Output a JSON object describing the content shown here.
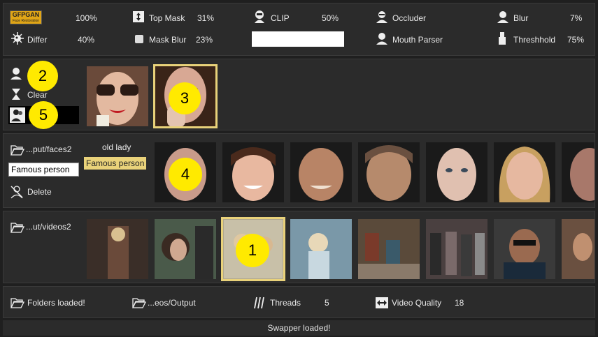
{
  "top": {
    "gfpgan_logo": "GFPGAN",
    "gfpgan_sub": "Face Restoration",
    "gfpgan_value": "100%",
    "top_mask_label": "Top Mask",
    "top_mask_value": "31%",
    "clip_label": "CLIP",
    "clip_value": "50%",
    "occluder_label": "Occluder",
    "blur_label": "Blur",
    "blur_value": "7%",
    "differ_label": "Differ",
    "differ_value": "40%",
    "mask_blur_label": "Mask Blur",
    "mask_blur_value": "23%",
    "clip_text": "",
    "mouth_parser_label": "Mouth Parser",
    "threshold_label": "Threshhold",
    "threshold_value": "75%"
  },
  "source": {
    "clear_label": "Clear",
    "markers": [
      "2",
      "5",
      "3"
    ]
  },
  "faces": {
    "folder_label": "...put/faces2",
    "name_value": "Famous person",
    "saved_name": "old lady",
    "highlight_name": "Famous person",
    "delete_label": "Delete",
    "marker": "4"
  },
  "videos": {
    "folder_label": "...ut/videos2",
    "marker": "1"
  },
  "bottom": {
    "folders_loaded": "Folders loaded!",
    "output_folder": "...eos/Output",
    "threads_label": "Threads",
    "threads_value": "5",
    "video_quality_label": "Video Quality",
    "video_quality_value": "18"
  },
  "status": "Swapper loaded!",
  "colors": {
    "accent": "#e9d27a",
    "marker": "#ffea00",
    "panel": "#2b2b2b",
    "bg": "#1f1f1f"
  },
  "icons": [
    "person-icon",
    "arrows-vertical-icon",
    "hazmat-icon",
    "virus-icon",
    "square-icon",
    "folder-icon",
    "delete-icon",
    "threads-icon",
    "width-arrows-icon"
  ]
}
